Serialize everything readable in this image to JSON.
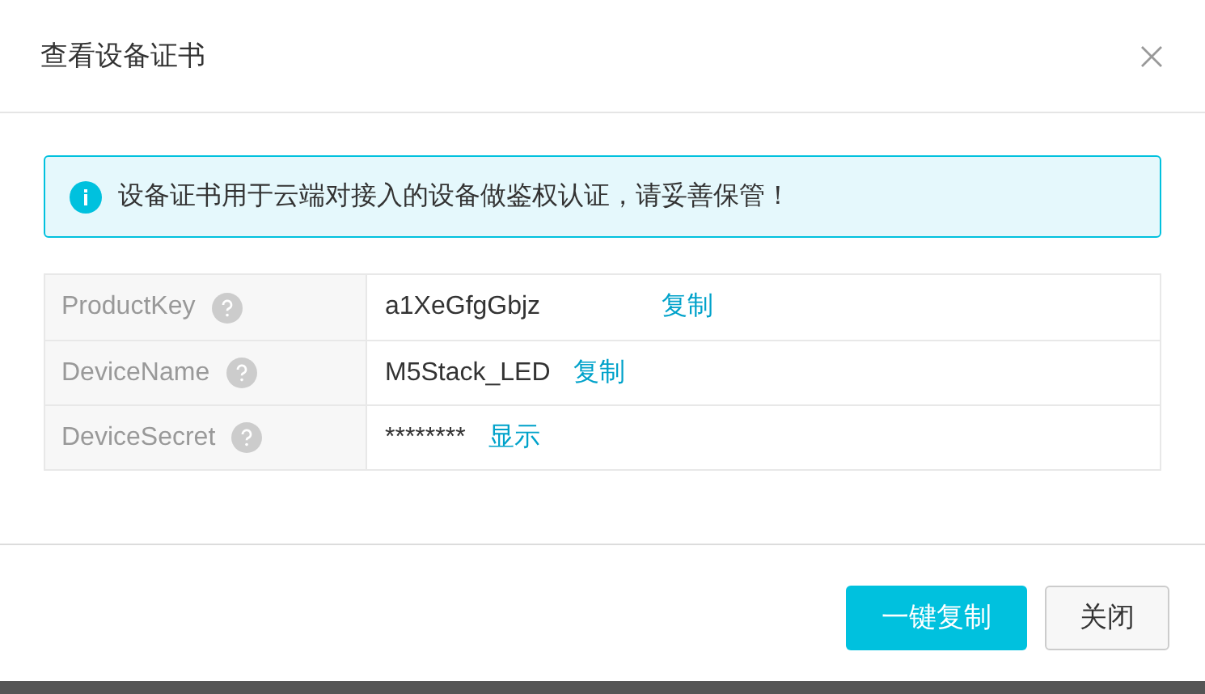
{
  "dialog": {
    "title": "查看设备证书",
    "alert": "设备证书用于云端对接入的设备做鉴权认证，请妥善保管！",
    "rows": [
      {
        "label": "ProductKey",
        "value": "a1XeGfgGbjz",
        "action": "复制"
      },
      {
        "label": "DeviceName",
        "value": "M5Stack_LED",
        "action": "复制"
      },
      {
        "label": "DeviceSecret",
        "value": "********",
        "action": "显示"
      }
    ],
    "buttons": [
      {
        "label": "一键复制",
        "kind": "primary"
      },
      {
        "label": "关闭",
        "kind": "secondary"
      }
    ]
  }
}
